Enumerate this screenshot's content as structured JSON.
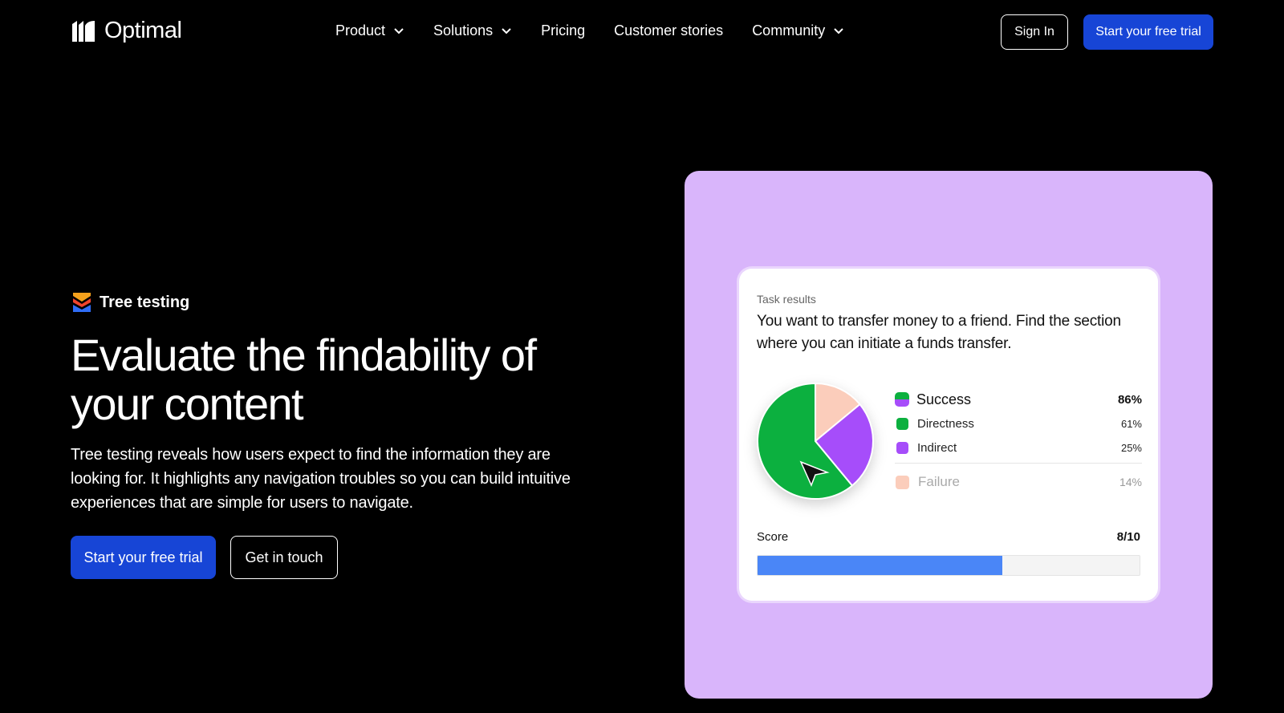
{
  "nav": {
    "brand": "Optimal",
    "links": [
      {
        "label": "Product",
        "has_dropdown": true
      },
      {
        "label": "Solutions",
        "has_dropdown": true
      },
      {
        "label": "Pricing",
        "has_dropdown": false
      },
      {
        "label": "Customer stories",
        "has_dropdown": false
      },
      {
        "label": "Community",
        "has_dropdown": true
      }
    ],
    "sign_in": "Sign In",
    "cta": "Start your free trial"
  },
  "hero": {
    "badge": "Tree testing",
    "headline": "Evaluate the findability of your content",
    "lead": "Tree testing reveals how users expect to find the information they are looking for. It highlights any navigation troubles so you can build intuitive experiences that are simple for users to navigate.",
    "primary_cta": "Start your free trial",
    "secondary_cta": "Get in touch"
  },
  "card": {
    "label": "Task results",
    "question": "You want to transfer money to a friend. Find the section where you can initiate a funds transfer.",
    "legend": [
      {
        "name": "Success",
        "value": "86%"
      },
      {
        "name": "Directness",
        "value": "61%"
      },
      {
        "name": "Indirect",
        "value": "25%"
      },
      {
        "name": "Failure",
        "value": "14%"
      }
    ],
    "score_label": "Score",
    "score_value": "8/10",
    "score_fraction": 0.64
  },
  "chart_data": {
    "type": "pie",
    "slices": [
      {
        "name": "Directness",
        "value": 61
      },
      {
        "name": "Indirect",
        "value": 25
      },
      {
        "name": "Failure",
        "value": 14
      }
    ]
  },
  "colors": {
    "accent_blue": "#1745d6",
    "panel_lilac": "#d9b5fb",
    "directness_green": "#0cb03f",
    "indirect_purple": "#a64dfa",
    "failure_peach": "#fbcdbb",
    "score_fill": "#4a86f7"
  },
  "icons": {
    "logo": "optimal-logo-icon",
    "dropdown": "chevron-down-icon",
    "badge": "tree-testing-icon",
    "cursor": "cursor-arrow-icon"
  }
}
